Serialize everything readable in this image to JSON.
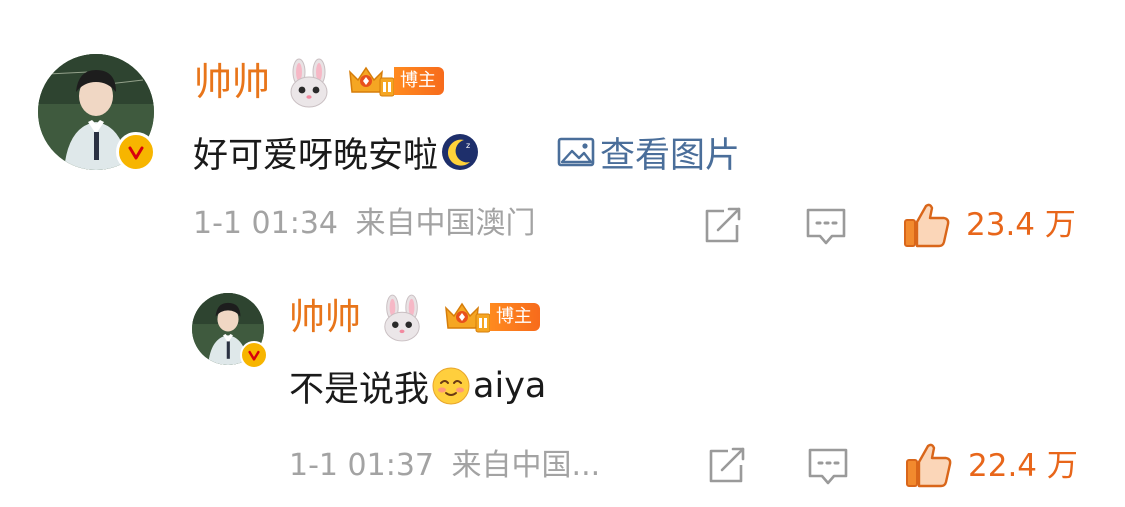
{
  "comments": [
    {
      "username": "帅帅",
      "rabbit_emoji": "rabbit-icon",
      "badge_label": "博主",
      "text": "好可爱呀晚安啦",
      "text_emoji": "moon-sleep-emoji",
      "view_image_label": "查看图片",
      "timestamp": "1-1 01:34",
      "location": "来自中国澳门",
      "likes": "23.4 万"
    },
    {
      "username": "帅帅",
      "rabbit_emoji": "rabbit-icon",
      "badge_label": "博主",
      "text": "不是说我",
      "text_emoji": "shy-smile-emoji",
      "text_suffix": "aiya",
      "timestamp": "1-1 01:37",
      "location": "来自中国...",
      "likes": "22.4 万"
    }
  ],
  "colors": {
    "username": "#e8751a",
    "link": "#4a6e9a",
    "meta": "#a3a3a3",
    "like": "#e8661a",
    "badge": "#f76b1c",
    "verified": "#f7b500"
  }
}
